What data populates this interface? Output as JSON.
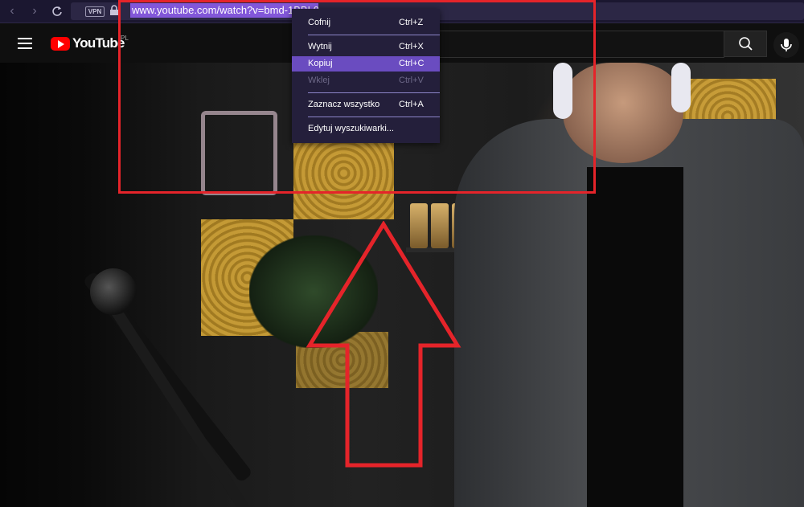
{
  "browser": {
    "vpn_label": "VPN",
    "url": "www.youtube.com/watch?v=bmd-1BBL0E"
  },
  "youtube": {
    "logo_text": "YouTube",
    "region": "PL"
  },
  "context_menu": {
    "items": [
      {
        "label": "Cofnij",
        "shortcut": "Ctrl+Z"
      },
      {
        "label": "Wytnij",
        "shortcut": "Ctrl+X"
      },
      {
        "label": "Kopiuj",
        "shortcut": "Ctrl+C"
      },
      {
        "label": "Wklej",
        "shortcut": "Ctrl+V"
      },
      {
        "label": "Zaznacz wszystko",
        "shortcut": "Ctrl+A"
      },
      {
        "label": "Edytuj wyszukiwarki...",
        "shortcut": ""
      }
    ]
  },
  "colors": {
    "annotation": "#e5242a",
    "menu_highlight": "#6a4cc0",
    "url_selection": "#8257d9"
  }
}
